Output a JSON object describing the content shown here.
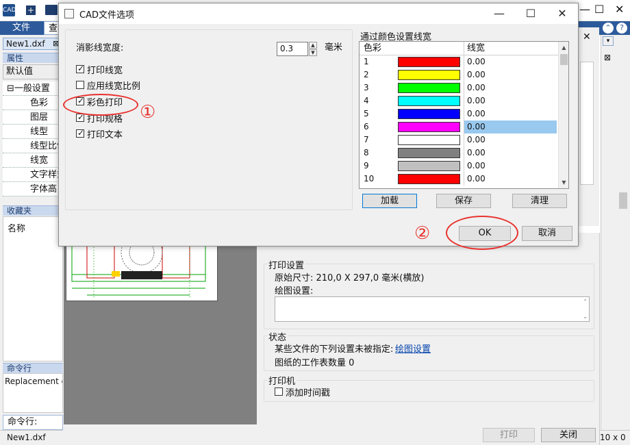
{
  "app": {
    "icon_text": "CAD",
    "menu": {
      "file": "文件",
      "view": "查看"
    },
    "doc_tab": "New1.dxf",
    "properties": {
      "header": "属性",
      "default_value": "默认值",
      "group": "⊟一般设置",
      "items": [
        "色彩",
        "图层",
        "线型",
        "线型比例",
        "线宽",
        "文字样式",
        "字体高"
      ]
    },
    "favorites": {
      "header": "收藏夹",
      "name_label": "名称"
    },
    "command": {
      "header": "命令行",
      "output": "Replacement of",
      "input_label": "命令行:"
    },
    "status": {
      "file": "New1.dxf",
      "coords": "10 x 0"
    }
  },
  "print_dialog": {
    "print_settings": {
      "title": "打印设置",
      "original_size": "原始尺寸: 210,0 X 297,0 毫米(横放)",
      "plot_settings_label": "绘图设置:"
    },
    "status": {
      "title": "状态",
      "unspecified": "某些文件的下列设置未被指定:",
      "link": "绘图设置",
      "sheet_count": "图纸的工作表数量 0"
    },
    "printer": {
      "title": "打印机",
      "timestamp_label": "添加时间戳",
      "timestamp_checked": false
    },
    "buttons": {
      "print": "打印",
      "close": "关闭"
    }
  },
  "dialog": {
    "title": "CAD文件选项",
    "controls": {
      "minimize": "—",
      "maximize": "☐",
      "close": "✕"
    },
    "hide_line_width": {
      "label": "消影线宽度:",
      "value": "0.3",
      "unit": "毫米"
    },
    "options": [
      {
        "label": "打印线宽",
        "checked": true
      },
      {
        "label": "应用线宽比例",
        "checked": false
      },
      {
        "label": "彩色打印",
        "checked": true
      },
      {
        "label": "打印规格",
        "checked": true
      },
      {
        "label": "打印文本",
        "checked": true
      }
    ],
    "color_table": {
      "title": "通过颜色设置线宽",
      "columns": [
        "色彩",
        "线宽"
      ],
      "rows": [
        {
          "index": "1",
          "color": "#ff0000",
          "width": "0.00"
        },
        {
          "index": "2",
          "color": "#ffff00",
          "width": "0.00"
        },
        {
          "index": "3",
          "color": "#00ff00",
          "width": "0.00"
        },
        {
          "index": "4",
          "color": "#00ffff",
          "width": "0.00"
        },
        {
          "index": "5",
          "color": "#0000ff",
          "width": "0.00"
        },
        {
          "index": "6",
          "color": "#ff00ff",
          "width": "0.00",
          "selected": true
        },
        {
          "index": "7",
          "color": "#ffffff",
          "width": "0.00"
        },
        {
          "index": "8",
          "color": "#808080",
          "width": "0.00"
        },
        {
          "index": "9",
          "color": "#c0c0c0",
          "width": "0.00"
        },
        {
          "index": "10",
          "color": "#ff0000",
          "width": "0.00"
        }
      ]
    },
    "table_buttons": {
      "load": "加载",
      "save": "保存",
      "clear": "清理"
    },
    "ok": "OK",
    "cancel": "取消",
    "annotations": {
      "first": "①",
      "second": "②"
    }
  },
  "colors": {
    "annotation": "#e8322e",
    "menu_bar": "#2d5a9b",
    "selection": "#99c9ef"
  }
}
